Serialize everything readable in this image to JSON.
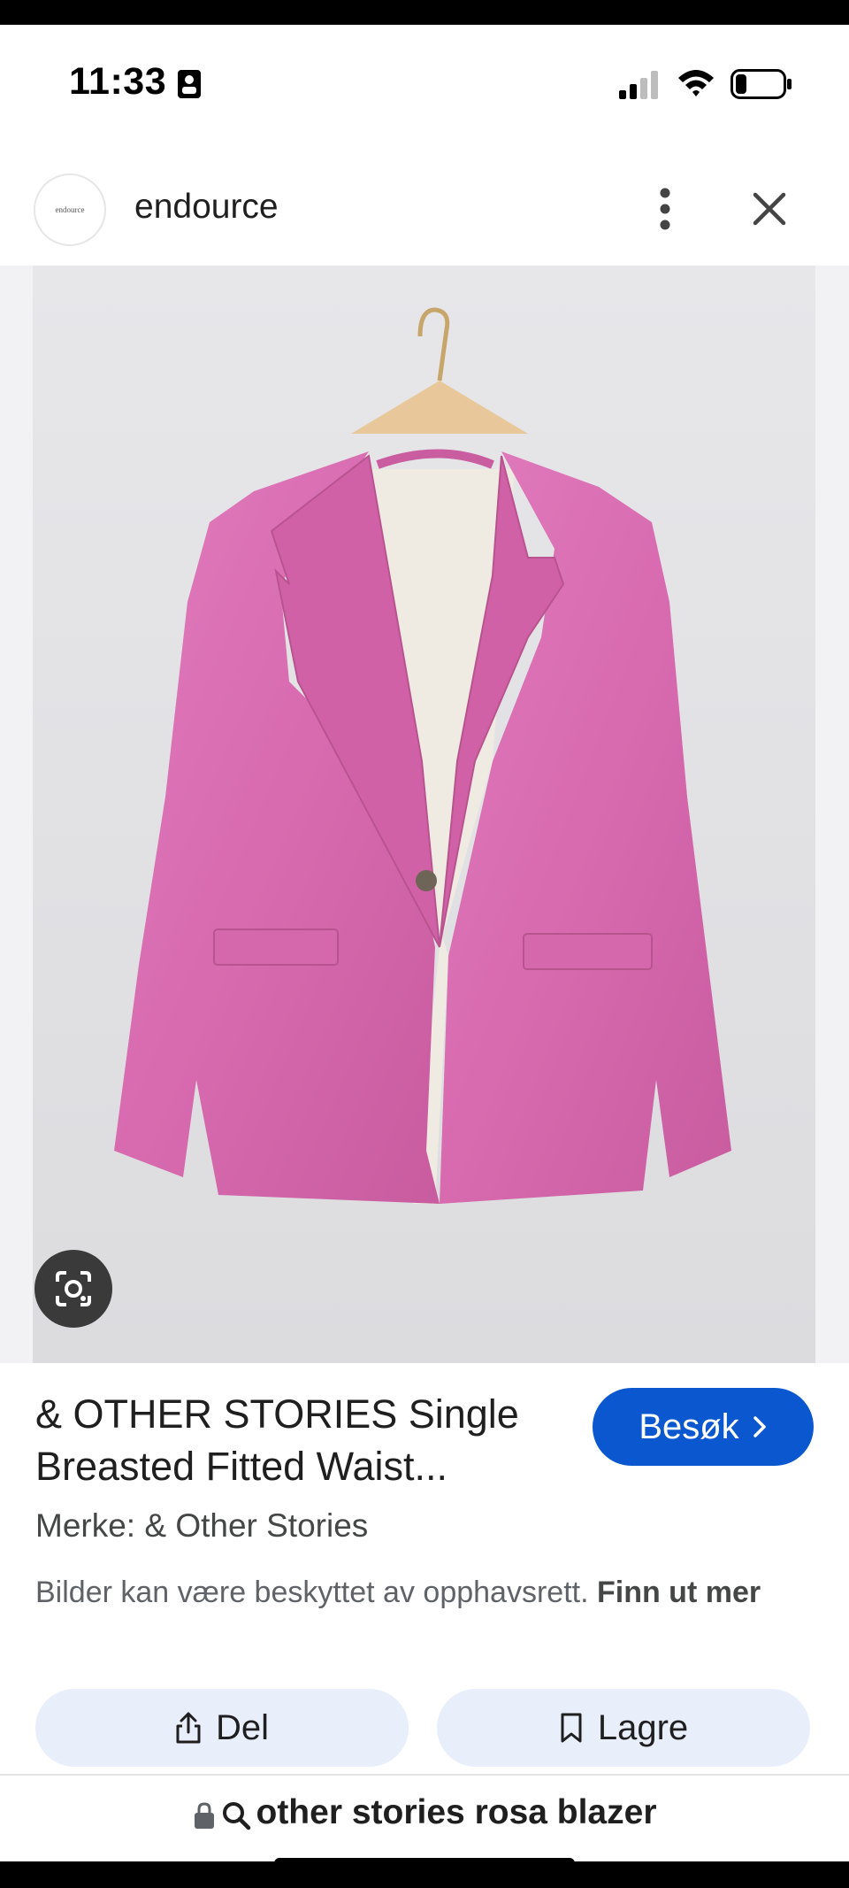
{
  "status_bar": {
    "time": "11:33"
  },
  "header": {
    "site_name": "endource",
    "logo_text": "endource"
  },
  "product": {
    "title": "& OTHER STORIES Single Breasted Fitted Waist...",
    "brand": "Merke: & Other Stories",
    "notice_text": "Bilder kan være beskyttet av opphavsrett.",
    "notice_link": "Finn ut mer",
    "visit_label": "Besøk"
  },
  "actions": {
    "share_label": "Del",
    "save_label": "Lagre"
  },
  "search": {
    "query": "other stories rosa blazer"
  },
  "colors": {
    "accent": "#0b57d0",
    "pill_bg": "#e9eefb",
    "blazer_pink": "#d86aaf"
  },
  "icons": [
    "id-card-icon",
    "signal-icon",
    "wifi-icon",
    "battery-icon",
    "more-vert-icon",
    "close-icon",
    "lens-icon",
    "chevron-right-icon",
    "share-icon",
    "bookmark-icon",
    "lock-icon",
    "search-icon"
  ]
}
